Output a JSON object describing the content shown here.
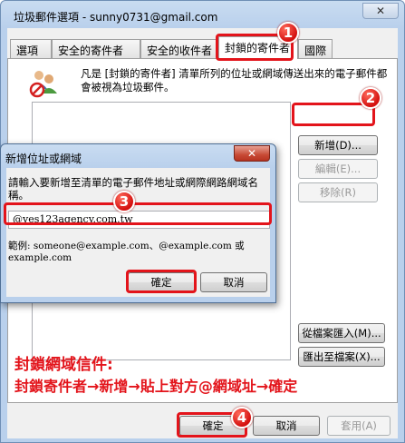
{
  "window": {
    "title": "垃圾郵件選項 - sunny0731@gmail.com",
    "close_glyph": "✕"
  },
  "tabs": [
    {
      "label": "選項"
    },
    {
      "label": "安全的寄件者"
    },
    {
      "label": "安全的收件者"
    },
    {
      "label": "封鎖的寄件者"
    },
    {
      "label": "國際"
    }
  ],
  "panel": {
    "intro": "凡是 [封鎖的寄件者] 清單所列的位址或網域傳送出來的電子郵件都會被視為垃圾郵件。",
    "buttons": {
      "add": "新增(D)...",
      "edit": "編輯(E)...",
      "remove": "移除(R)",
      "import": "從檔案匯入(M)...",
      "export": "匯出至檔案(X)..."
    }
  },
  "dialog": {
    "title": "新增位址或網域",
    "close_glyph": "✕",
    "prompt": "請輸入要新增至清單的電子郵件地址或網際網路網域名稱。",
    "input_value": "@yes123agency.com.tw",
    "example": "範例: someone@example.com、@example.com 或 example.com",
    "ok": "確定",
    "cancel": "取消"
  },
  "caption": {
    "line1": "封鎖網域信件:",
    "line2": "封鎖寄件者→新增→貼上對方@網域址→確定"
  },
  "footer": {
    "ok": "確定",
    "cancel": "取消",
    "apply": "套用(A)"
  },
  "badges": [
    "1",
    "2",
    "3",
    "4"
  ],
  "colors": {
    "highlight": "#e3141b",
    "title_bar": "#b9d0ec"
  }
}
